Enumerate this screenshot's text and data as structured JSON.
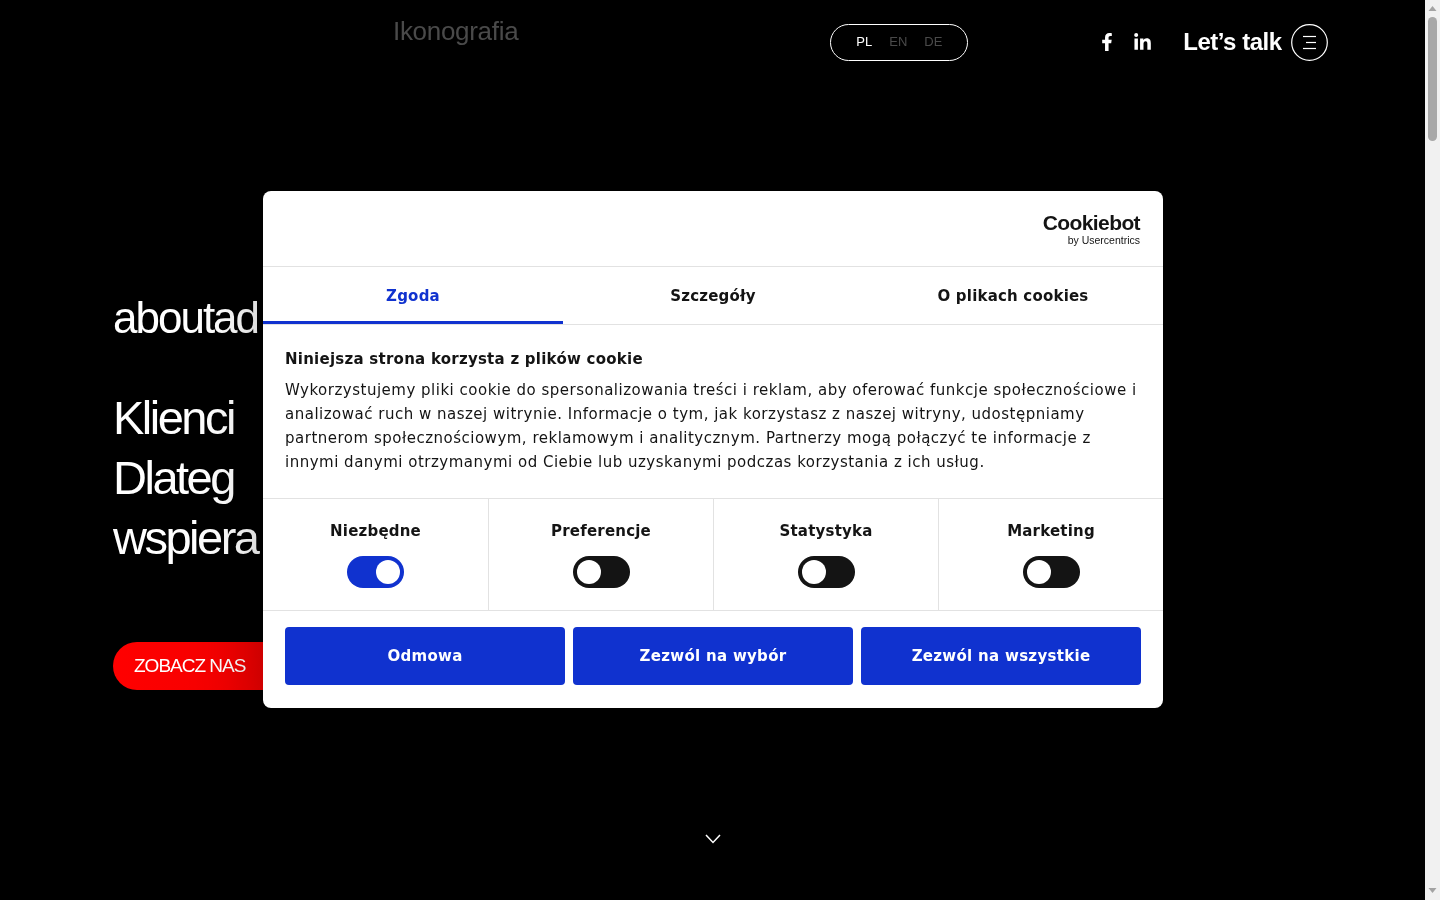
{
  "nav": {
    "link": "Ikonografia",
    "languages": [
      {
        "label": "PL",
        "selected": true
      },
      {
        "label": "EN",
        "selected": false
      },
      {
        "label": "DE",
        "selected": false
      }
    ],
    "cta": "Let’s talk"
  },
  "hero": {
    "logo": "aboutad",
    "headline": [
      "Klienci",
      "Dlateg",
      "wspiera"
    ],
    "button": "ZOBACZ NAS"
  },
  "cookie_dialog": {
    "logo": {
      "name": "Cookiebot",
      "tagline": "by Usercentrics"
    },
    "tabs": [
      {
        "label": "Zgoda",
        "selected": true
      },
      {
        "label": "Szczegóły",
        "selected": false
      },
      {
        "label": "O plikach cookies",
        "selected": false
      }
    ],
    "title": "Niniejsza strona korzysta z plików cookie",
    "text": "Wykorzystujemy pliki cookie do spersonalizowania treści i reklam, aby oferować funkcje społecznościowe i analizować ruch w naszej witrynie. Informacje o tym, jak korzystasz z naszej witryny, udostępniamy partnerom społecznościowym, reklamowym i analitycznym. Partnerzy mogą połączyć te informacje z innymi danymi otrzymanymi od Ciebie lub uzyskanymi podczas korzystania z ich usług.",
    "consents": [
      {
        "label": "Niezbędne",
        "on": true
      },
      {
        "label": "Preferencje",
        "on": false
      },
      {
        "label": "Statystyka",
        "on": false
      },
      {
        "label": "Marketing",
        "on": false
      }
    ],
    "buttons": [
      {
        "label": "Odmowa"
      },
      {
        "label": "Zezwól na wybór"
      },
      {
        "label": "Zezwól na wszystkie"
      }
    ]
  }
}
